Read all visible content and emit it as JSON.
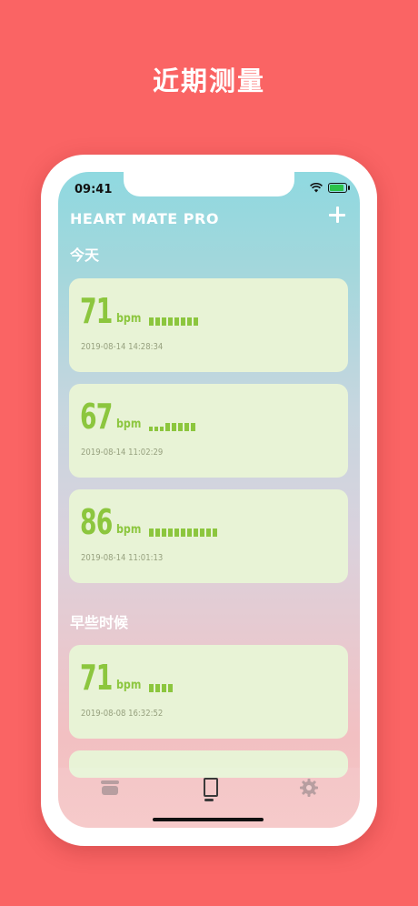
{
  "headline": "近期测量",
  "status": {
    "time": "09:41"
  },
  "app": {
    "title": "HEART MATE PRO"
  },
  "sections": {
    "today": "今天",
    "earlier": "早些时候"
  },
  "measurements": [
    {
      "bpm": "71",
      "unit": "bpm",
      "timestamp": "2019-08-14  14:28:34",
      "level": 8
    },
    {
      "bpm": "67",
      "unit": "bpm",
      "timestamp": "2019-08-14  11:02:29",
      "level": 8
    },
    {
      "bpm": "86",
      "unit": "bpm",
      "timestamp": "2019-08-14  11:01:13",
      "level": 11
    },
    {
      "bpm": "71",
      "unit": "bpm",
      "timestamp": "2019-08-08  16:32:52",
      "level": 4
    }
  ],
  "tabs": [
    "history-icon",
    "measure-icon",
    "gear-icon"
  ],
  "colors": {
    "background": "#fa6464",
    "accent": "#8cc63e",
    "card": "#e8f3d6"
  }
}
